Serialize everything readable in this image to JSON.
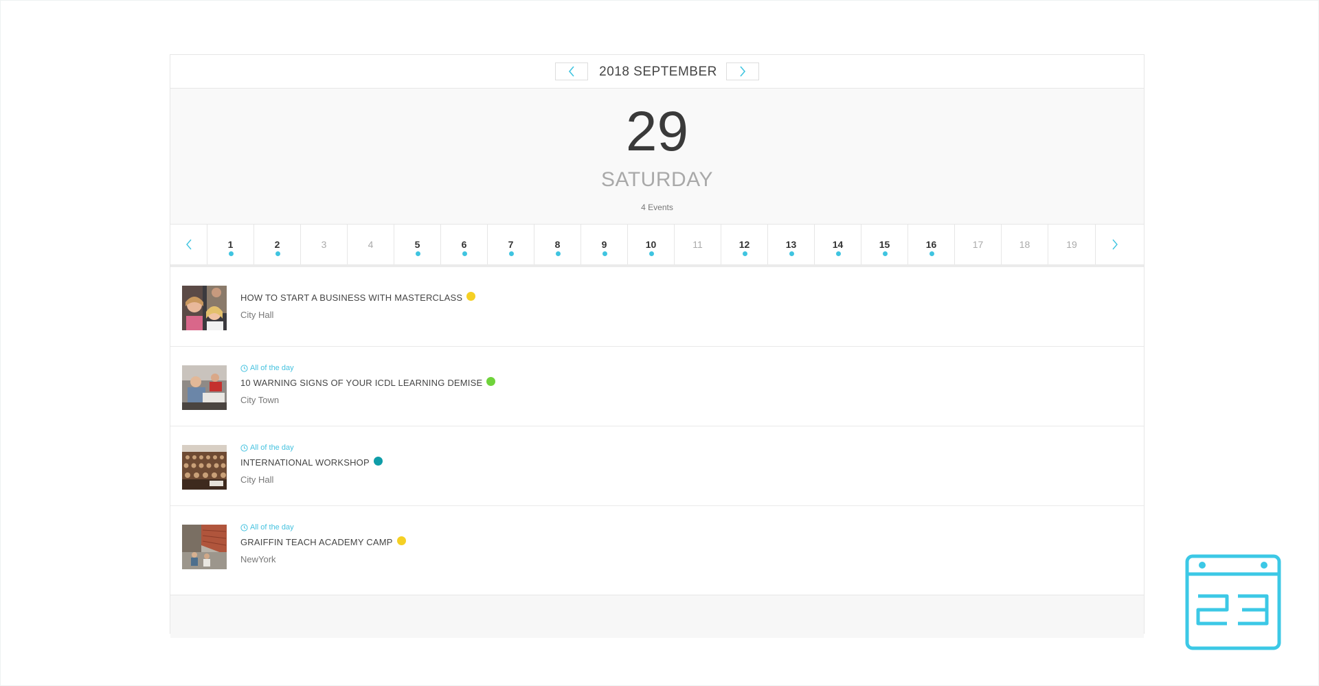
{
  "month_header": {
    "title": "2018 SEPTEMBER",
    "prev_icon": "chevron-left-icon",
    "next_icon": "chevron-right-icon"
  },
  "selected_date": {
    "day": "29",
    "weekday": "SATURDAY",
    "events_count": "4 Events"
  },
  "day_strip": {
    "days": [
      {
        "num": "1",
        "has_events": true
      },
      {
        "num": "2",
        "has_events": true
      },
      {
        "num": "3",
        "has_events": false
      },
      {
        "num": "4",
        "has_events": false
      },
      {
        "num": "5",
        "has_events": true
      },
      {
        "num": "6",
        "has_events": true
      },
      {
        "num": "7",
        "has_events": true
      },
      {
        "num": "8",
        "has_events": true
      },
      {
        "num": "9",
        "has_events": true
      },
      {
        "num": "10",
        "has_events": true
      },
      {
        "num": "11",
        "has_events": false
      },
      {
        "num": "12",
        "has_events": true
      },
      {
        "num": "13",
        "has_events": true
      },
      {
        "num": "14",
        "has_events": true
      },
      {
        "num": "15",
        "has_events": true
      },
      {
        "num": "16",
        "has_events": true
      },
      {
        "num": "17",
        "has_events": false
      },
      {
        "num": "18",
        "has_events": false
      },
      {
        "num": "19",
        "has_events": false
      }
    ]
  },
  "events": [
    {
      "time": "",
      "title": "HOW TO START A BUSINESS WITH MASTERCLASS",
      "location": "City Hall",
      "category_color": "#f5d024"
    },
    {
      "time": "All of the day",
      "title": "10 WARNING SIGNS OF YOUR ICDL LEARNING DEMISE",
      "location": "City Town",
      "category_color": "#6fd33b"
    },
    {
      "time": "All of the day",
      "title": "INTERNATIONAL WORKSHOP",
      "location": "City Hall",
      "category_color": "#0f9da8"
    },
    {
      "time": "All of the day",
      "title": "GRAIFFIN TEACH ACADEMY CAMP",
      "location": "NewYork",
      "category_color": "#f5d024"
    }
  ],
  "colors": {
    "accent": "#3fc4e0",
    "dot": "#3fc4e0"
  },
  "floating_icon": {
    "icon": "calendar-icon",
    "label": "23"
  }
}
